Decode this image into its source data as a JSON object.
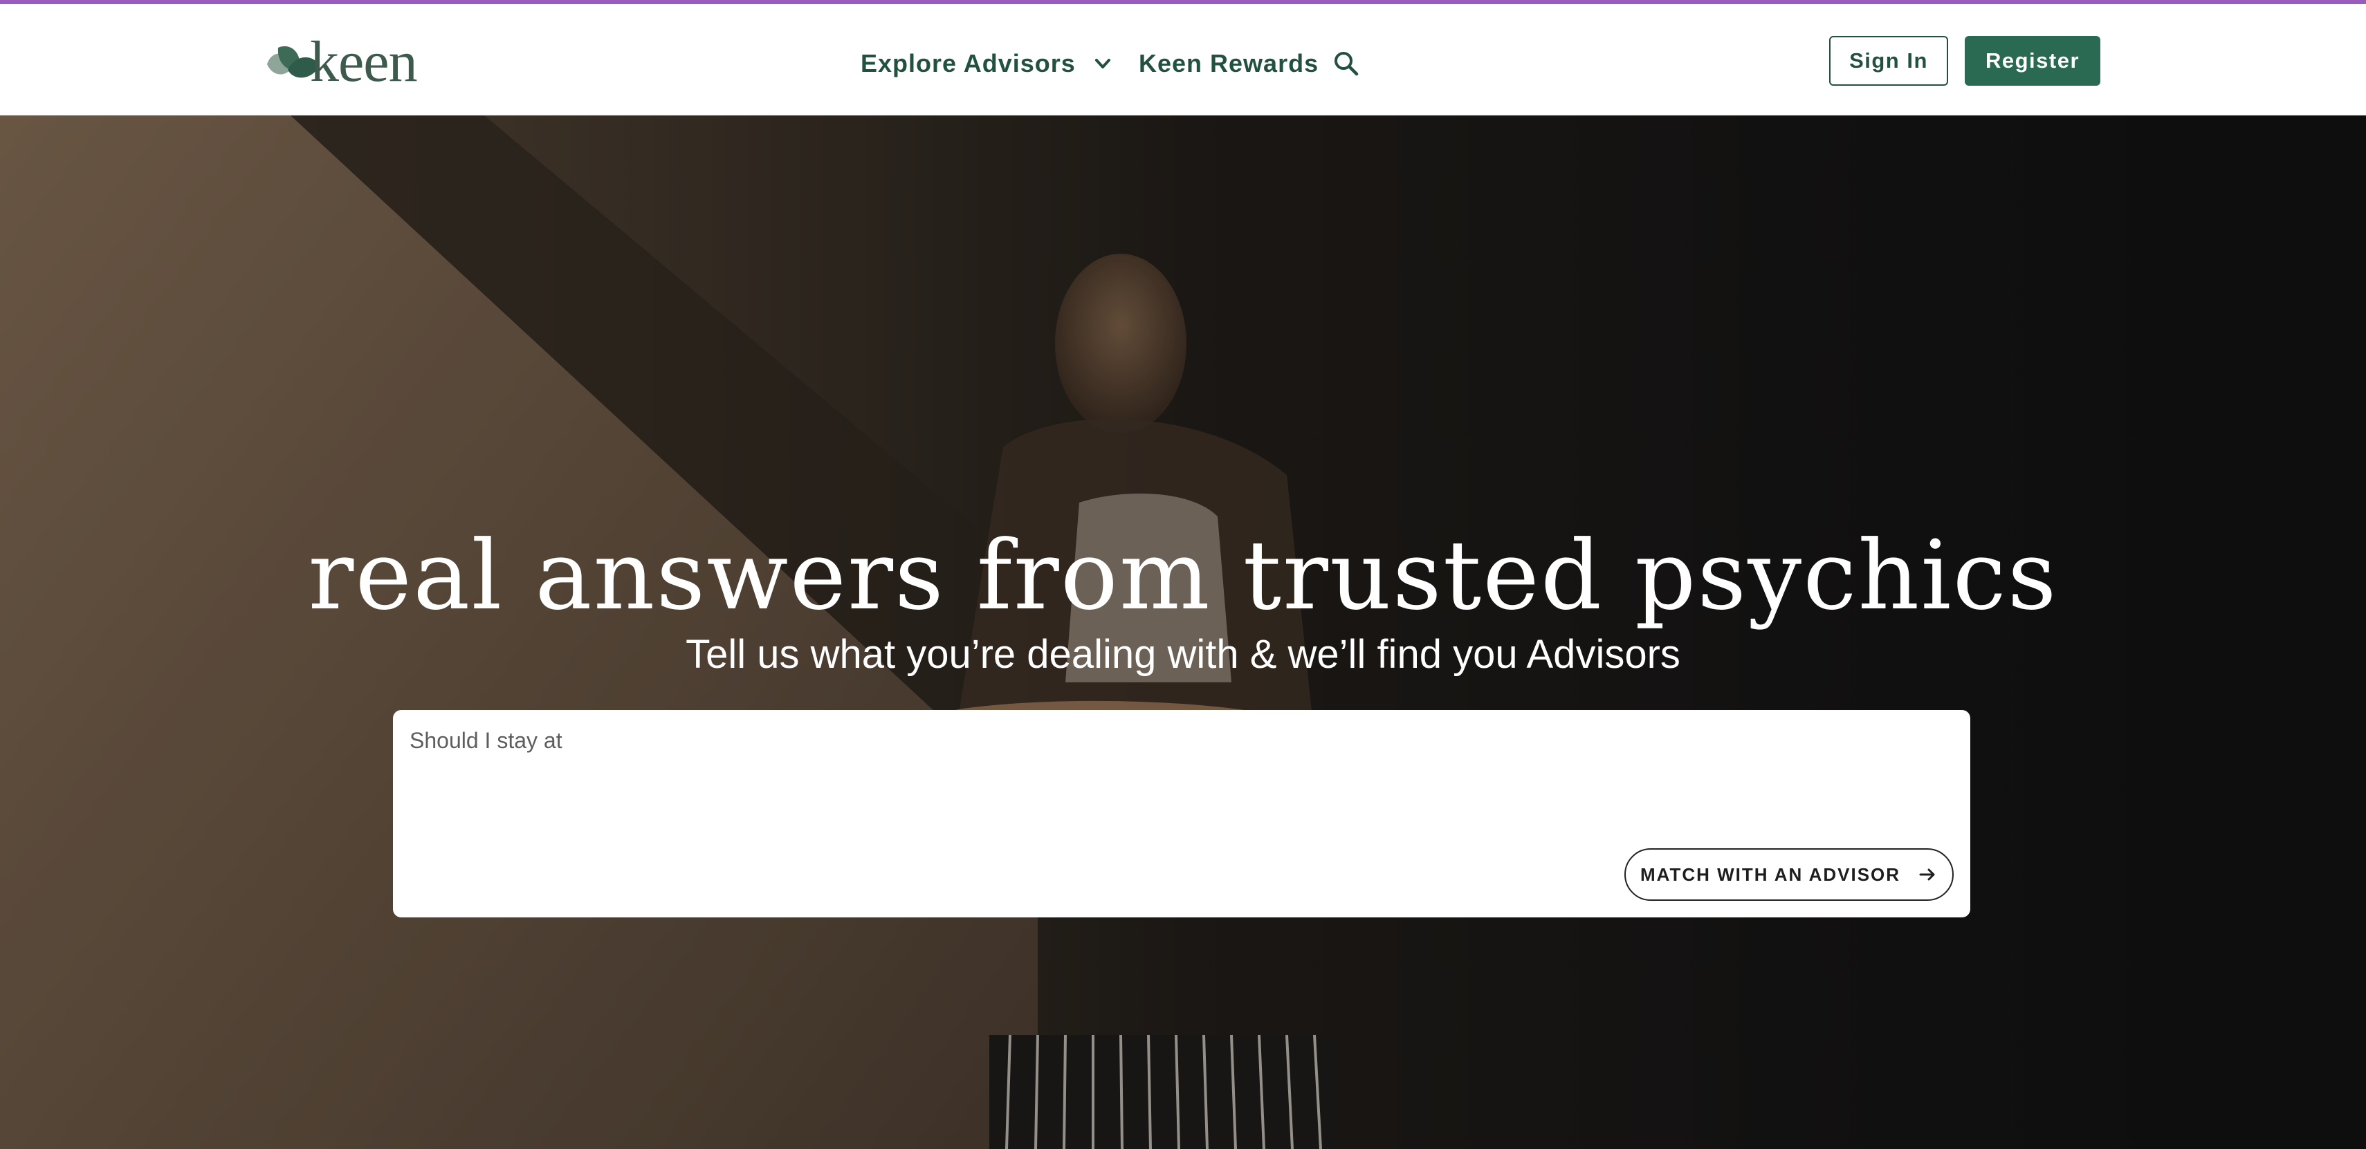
{
  "brand": {
    "name": "keen",
    "accent_bar": "#9a5bbd",
    "primary_green": "#2a6a52",
    "icon": "leaf-logo-icon"
  },
  "nav": {
    "explore_label": "Explore Advisors",
    "explore_icon": "chevron-down-icon",
    "rewards_label": "Keen Rewards",
    "search_icon": "search-icon"
  },
  "actions": {
    "signin_label": "Sign In",
    "register_label": "Register"
  },
  "hero": {
    "title": "real answers from trusted psychics",
    "subtitle": "Tell us what you’re dealing with & we’ll find you Advisors",
    "query_value": "Should I stay at",
    "match_label": "MATCH WITH AN ADVISOR",
    "match_icon": "arrow-right-icon"
  }
}
